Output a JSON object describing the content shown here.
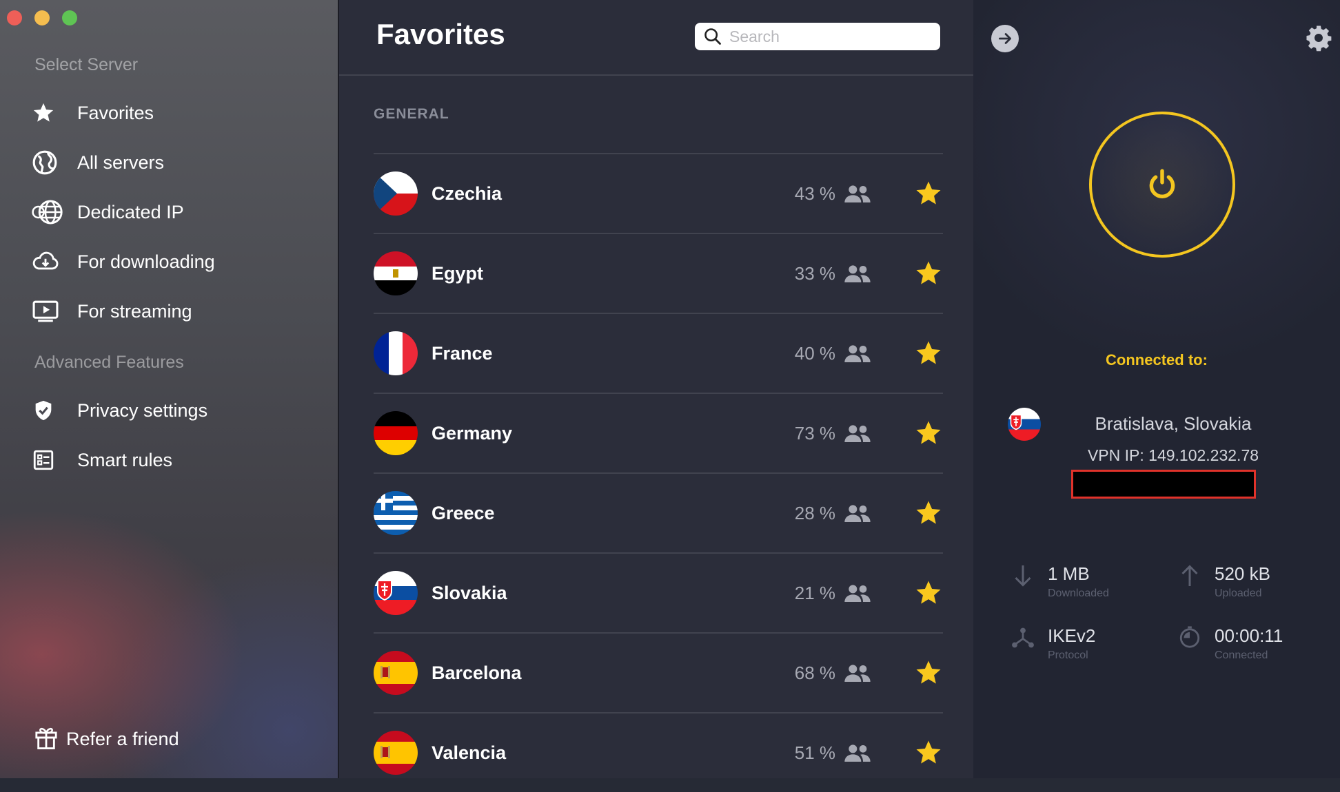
{
  "window": {
    "traffic_lights": {
      "close": "#ee5f58",
      "minimize": "#f5bd4f",
      "zoom": "#5fc454"
    }
  },
  "sidebar": {
    "section_select": "Select Server",
    "items": [
      {
        "label": "Favorites",
        "icon": "star-icon"
      },
      {
        "label": "All servers",
        "icon": "globe-icon"
      },
      {
        "label": "Dedicated IP",
        "icon": "dedicated-globe-icon"
      },
      {
        "label": "For downloading",
        "icon": "cloud-download-icon"
      },
      {
        "label": "For streaming",
        "icon": "play-screen-icon"
      }
    ],
    "section_advanced": "Advanced Features",
    "advanced_items": [
      {
        "label": "Privacy settings",
        "icon": "shield-check-icon"
      },
      {
        "label": "Smart rules",
        "icon": "rules-list-icon"
      }
    ],
    "refer": {
      "label": "Refer a friend",
      "icon": "gift-icon"
    }
  },
  "main": {
    "title": "Favorites",
    "search": {
      "placeholder": "Search",
      "value": ""
    },
    "group_label": "GENERAL",
    "servers": [
      {
        "name": "Czechia",
        "load": "43 %",
        "flag": "czechia"
      },
      {
        "name": "Egypt",
        "load": "33 %",
        "flag": "egypt"
      },
      {
        "name": "France",
        "load": "40 %",
        "flag": "france"
      },
      {
        "name": "Germany",
        "load": "73 %",
        "flag": "germany"
      },
      {
        "name": "Greece",
        "load": "28 %",
        "flag": "greece"
      },
      {
        "name": "Slovakia",
        "load": "21 %",
        "flag": "slovakia"
      },
      {
        "name": "Barcelona",
        "load": "68 %",
        "flag": "spain"
      },
      {
        "name": "Valencia",
        "load": "51 %",
        "flag": "spain"
      }
    ]
  },
  "status": {
    "connected_label": "Connected to:",
    "location": "Bratislava, Slovakia",
    "vpn_ip": "VPN IP: 149.102.232.78",
    "downloaded": {
      "value": "1 MB",
      "label": "Downloaded"
    },
    "uploaded": {
      "value": "520 kB",
      "label": "Uploaded"
    },
    "protocol": {
      "value": "IKEv2",
      "label": "Protocol"
    },
    "connected_time": {
      "value": "00:00:11",
      "label": "Connected"
    }
  },
  "colors": {
    "accent": "#f4c620",
    "star": "#f9c81e",
    "redaction_border": "#e0322a"
  }
}
